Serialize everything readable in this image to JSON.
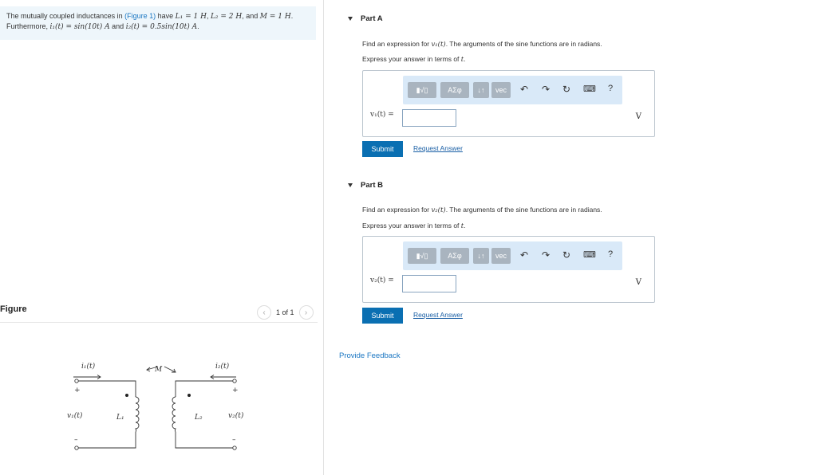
{
  "problem": {
    "line1_a": "The mutually coupled inductances in ",
    "figure_link": "(Figure 1)",
    "line1_b": " have ",
    "l1": "L₁ = 1 H",
    "sep1": ", ",
    "l2": "L₂ = 2 H",
    "sep2": ", and ",
    "m": "M = 1 H",
    "end1": ".",
    "line2_a": "Furthermore, ",
    "i1": "i₁(t) = sin(10t) A",
    "line2_b": " and ",
    "i2": "i₂(t) = 0.5sin(10t) A",
    "end2": "."
  },
  "figure": {
    "label": "Figure",
    "pager_text": "1 of 1",
    "prev_icon": "‹",
    "next_icon": "›",
    "circuit": {
      "i1": "i₁(t)",
      "i2": "i₂(t)",
      "m": "M",
      "v1": "v₁(t)",
      "v2": "v₂(t)",
      "l1": "L₁",
      "l2": "L₂",
      "plus": "+",
      "minus": "–"
    }
  },
  "part_a": {
    "title": "Part A",
    "prompt_a": "Find an expression for ",
    "prompt_var": "v₁(t)",
    "prompt_b": ". The arguments of the sine functions are in radians.",
    "express_a": "Express your answer in terms of ",
    "express_var": "t",
    "express_b": ".",
    "label": "v₁(t) =",
    "unit": "V",
    "submit": "Submit",
    "request": "Request Answer"
  },
  "part_b": {
    "title": "Part B",
    "prompt_a": "Find an expression for ",
    "prompt_var": "v₂(t)",
    "prompt_b": ". The arguments of the sine functions are in radians.",
    "express_a": "Express your answer in terms of ",
    "express_var": "t",
    "express_b": ".",
    "label": "v₂(t) =",
    "unit": "V",
    "submit": "Submit",
    "request": "Request Answer"
  },
  "toolbar": {
    "templates": "▮√▯",
    "greek": "ΑΣφ",
    "arrows": "↓↑",
    "vec": "vec",
    "undo": "↶",
    "redo": "↷",
    "reset": "↻",
    "keyboard": "⌨",
    "help": "?"
  },
  "feedback": "Provide Feedback",
  "colors": {
    "problem_bg": "#eef6fb",
    "toolbar_bg": "#d9e9f8",
    "submit_bg": "#0a6fb2",
    "link": "#1a76c2"
  }
}
